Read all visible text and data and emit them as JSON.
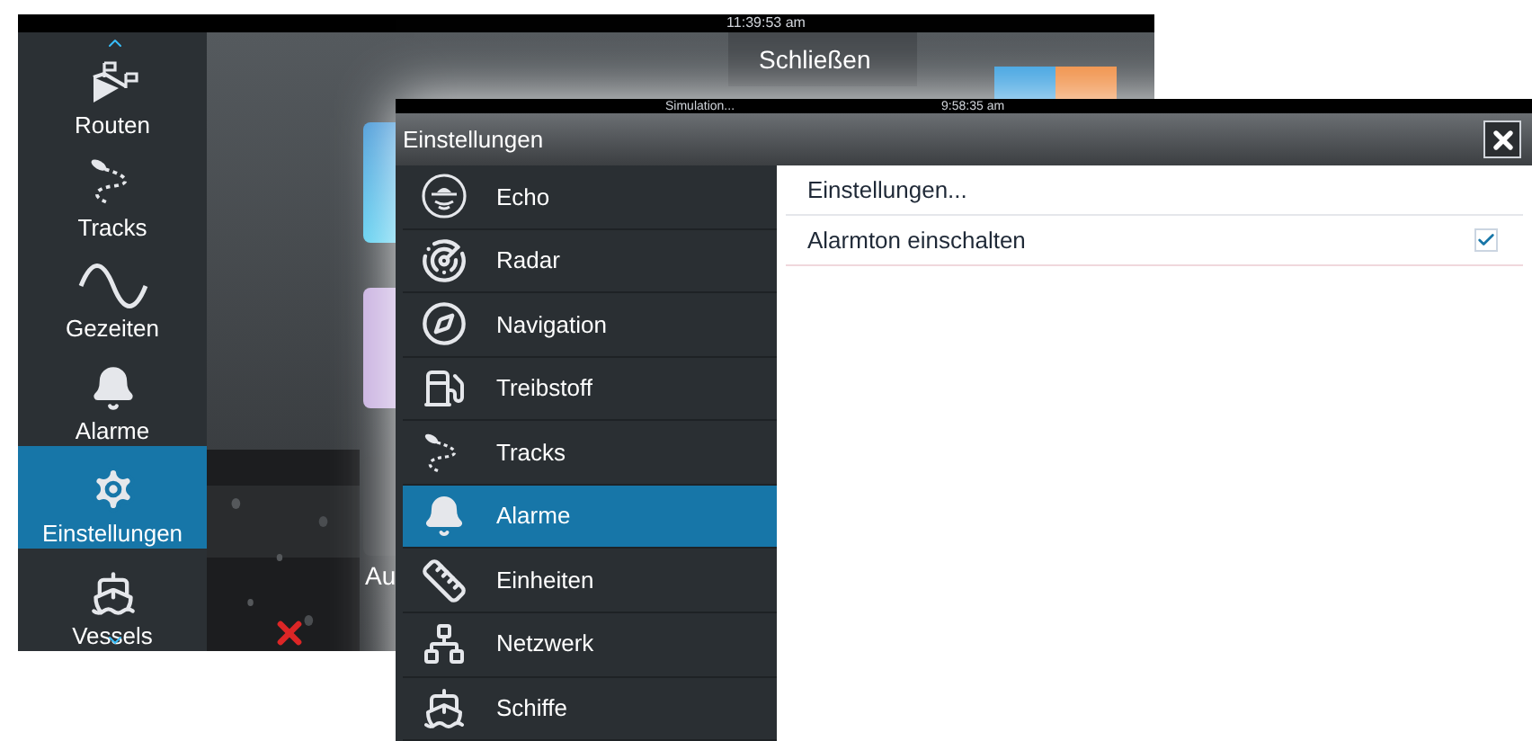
{
  "background_screen": {
    "clock": "11:39:53 am",
    "sidebar": {
      "items": [
        {
          "label": "Routen",
          "selected": false
        },
        {
          "label": "Tracks",
          "selected": false
        },
        {
          "label": "Gezeiten",
          "selected": false
        },
        {
          "label": "Alarme",
          "selected": false
        },
        {
          "label": "Einstellungen",
          "selected": true
        },
        {
          "label": "Vessels",
          "selected": false
        }
      ]
    },
    "close_button": "Schließen",
    "partial_label": "Au"
  },
  "dialog": {
    "status": "Simulation...",
    "clock": "9:58:35 am",
    "title": "Einstellungen",
    "menu": [
      {
        "label": "Echo",
        "selected": false
      },
      {
        "label": "Radar",
        "selected": false
      },
      {
        "label": "Navigation",
        "selected": false
      },
      {
        "label": "Treibstoff",
        "selected": false
      },
      {
        "label": "Tracks",
        "selected": false
      },
      {
        "label": "Alarme",
        "selected": true
      },
      {
        "label": "Einheiten",
        "selected": false
      },
      {
        "label": "Netzwerk",
        "selected": false
      },
      {
        "label": "Schiffe",
        "selected": false
      }
    ],
    "settings": [
      {
        "kind": "link",
        "label": "Einstellungen..."
      },
      {
        "kind": "checkbox",
        "label": "Alarmton einschalten",
        "checked": true
      }
    ]
  }
}
